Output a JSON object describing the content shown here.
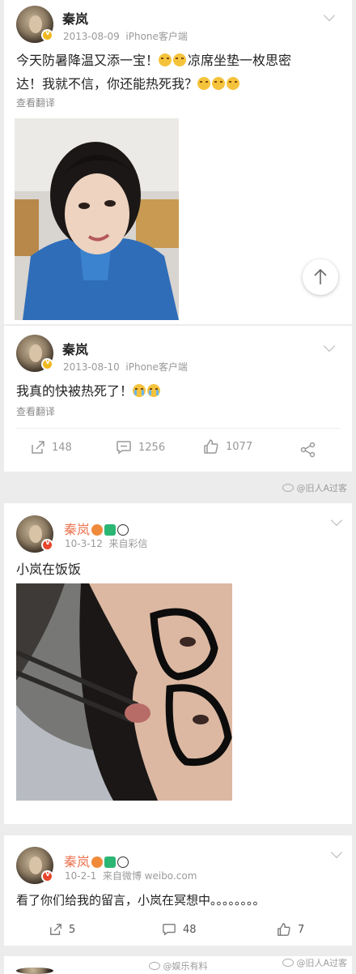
{
  "posts": [
    {
      "username": "秦岚",
      "date": "2013-08-09",
      "source": "iPhone客户端",
      "text_line1": "今天防暑降温又添一宝！",
      "text_line1b": "凉席坐垫一枚思密",
      "text_line2": "达！我就不信，你还能热死我？",
      "translate": "查看翻译"
    },
    {
      "username": "秦岚",
      "date": "2013-08-10",
      "source": "iPhone客户端",
      "text": "我真的快被热死了！",
      "translate": "查看翻译",
      "actions": {
        "repost": "148",
        "comment": "1256",
        "like": "1077"
      }
    },
    {
      "username": "秦岚",
      "date": "10-3-12",
      "source": "来自彩信",
      "text": "小岚在饭饭"
    },
    {
      "username": "秦岚",
      "date": "10-2-1",
      "source": "来自微博 weibo.com",
      "text": "看了你们给我的留言，小岚在冥想中。。。。。。。。",
      "actions": {
        "repost": "5",
        "comment": "48",
        "like": "7"
      }
    }
  ],
  "watermarks": {
    "w1": "@旧人A过客",
    "w2": "@旧人A过客",
    "w3": "@娱乐有料"
  },
  "icons": {
    "scroll_top": "arrow-up-icon",
    "repost": "repost-icon",
    "comment": "comment-icon",
    "like": "like-icon",
    "share": "share-icon",
    "more": "chevron-down-icon"
  },
  "colors": {
    "accent_orange": "#eb7350",
    "meta_gray": "#9a9a9a",
    "background": "#ececec"
  }
}
